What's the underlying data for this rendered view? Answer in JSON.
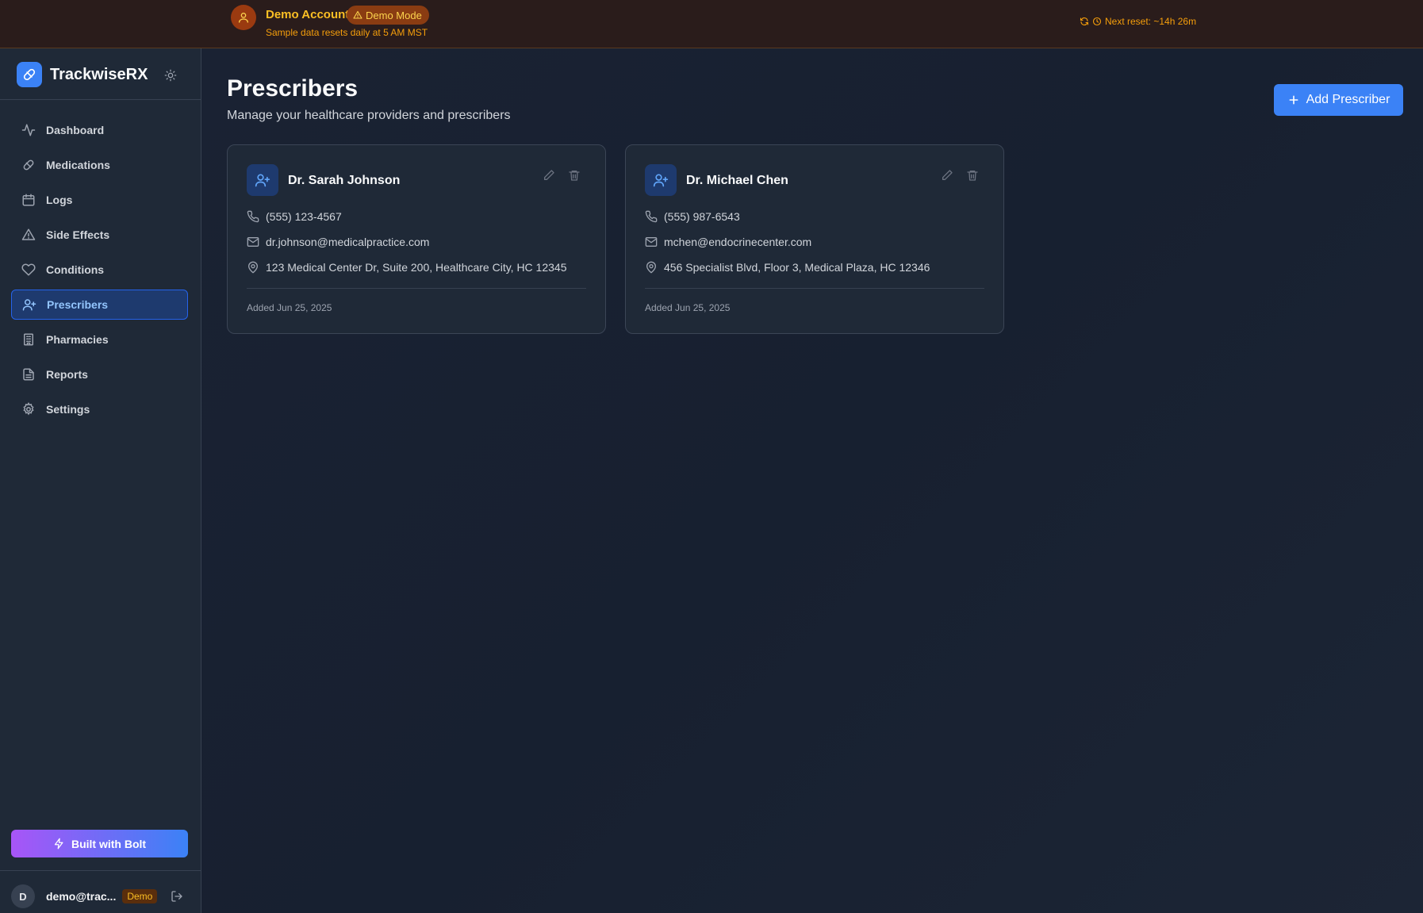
{
  "banner": {
    "title": "Demo Account",
    "badge": "Demo Mode",
    "subtitle": "Sample data resets daily at 5 AM MST",
    "reset": "Next reset: ~14h 26m"
  },
  "sidebar": {
    "brand": "TrackwiseRX",
    "items": [
      {
        "label": "Dashboard",
        "icon": "activity-icon"
      },
      {
        "label": "Medications",
        "icon": "pill-icon"
      },
      {
        "label": "Logs",
        "icon": "calendar-icon"
      },
      {
        "label": "Side Effects",
        "icon": "alert-triangle-icon"
      },
      {
        "label": "Conditions",
        "icon": "heart-icon"
      },
      {
        "label": "Prescribers",
        "icon": "user-plus-icon",
        "active": true
      },
      {
        "label": "Pharmacies",
        "icon": "building-icon"
      },
      {
        "label": "Reports",
        "icon": "file-text-icon"
      },
      {
        "label": "Settings",
        "icon": "gear-icon"
      }
    ],
    "bolt_label": "Built with Bolt",
    "user": {
      "initial": "D",
      "email": "demo@trac...",
      "badge": "Demo"
    }
  },
  "main": {
    "title": "Prescribers",
    "subtitle": "Manage your healthcare providers and prescribers",
    "add_label": "Add Prescriber",
    "prescribers": [
      {
        "name": "Dr. Sarah Johnson",
        "phone": "(555) 123-4567",
        "email": "dr.johnson@medicalpractice.com",
        "address": "123 Medical Center Dr, Suite 200, Healthcare City, HC 12345",
        "added": "Added Jun 25, 2025"
      },
      {
        "name": "Dr. Michael Chen",
        "phone": "(555) 987-6543",
        "email": "mchen@endocrinecenter.com",
        "address": "456 Specialist Blvd, Floor 3, Medical Plaza, HC 12346",
        "added": "Added Jun 25, 2025"
      }
    ]
  },
  "colors": {
    "accent": "#3b82f6",
    "warning": "#f59e0b",
    "sidebar_bg": "#1f2937",
    "main_bg": "#1b2332"
  }
}
